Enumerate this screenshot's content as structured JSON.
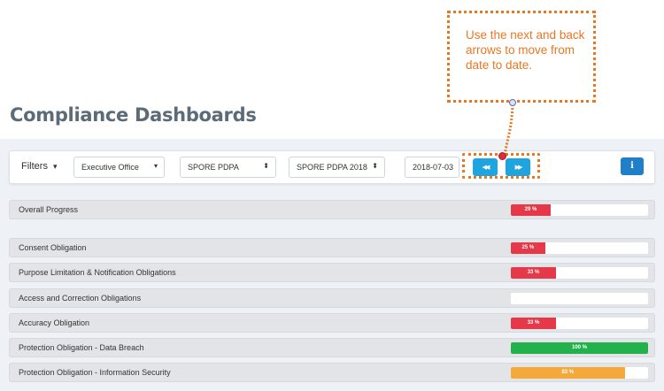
{
  "page": {
    "title": "Compliance Dashboards"
  },
  "filters": {
    "label": "Filters",
    "label_caret": "▾",
    "office": {
      "value": "Executive Office",
      "caret": "▾"
    },
    "regulation": {
      "value": "SPORE PDPA",
      "caret": "⬍"
    },
    "assessment": {
      "value": "SPORE PDPA 2018",
      "caret": "⬍"
    },
    "date": "2018-07-03",
    "back_glyph": "◀◀",
    "next_glyph": "▶▶",
    "info_glyph": "i"
  },
  "overall": {
    "label": "Overall Progress",
    "value": 29,
    "text": "29 %",
    "color": "#e53848"
  },
  "obligations": [
    {
      "label": "Consent Obligation",
      "value": 25,
      "text": "25 %",
      "color": "#e53848"
    },
    {
      "label": "Purpose Limitation & Notification Obligations",
      "value": 33,
      "text": "33 %",
      "color": "#e53848"
    },
    {
      "label": "Access and Correction Obligations",
      "value": 0,
      "text": "",
      "color": "#e53848"
    },
    {
      "label": "Accuracy Obligation",
      "value": 33,
      "text": "33 %",
      "color": "#e53848"
    },
    {
      "label": "Protection Obligation - Data Breach",
      "value": 100,
      "text": "100 %",
      "color": "#22b14c"
    },
    {
      "label": "Protection Obligation - Information Security",
      "value": 83,
      "text": "83 %",
      "color": "#f6a93b"
    }
  ],
  "callout": {
    "text": "Use the next and back arrows to move from date to date.",
    "color": "#e87722"
  }
}
